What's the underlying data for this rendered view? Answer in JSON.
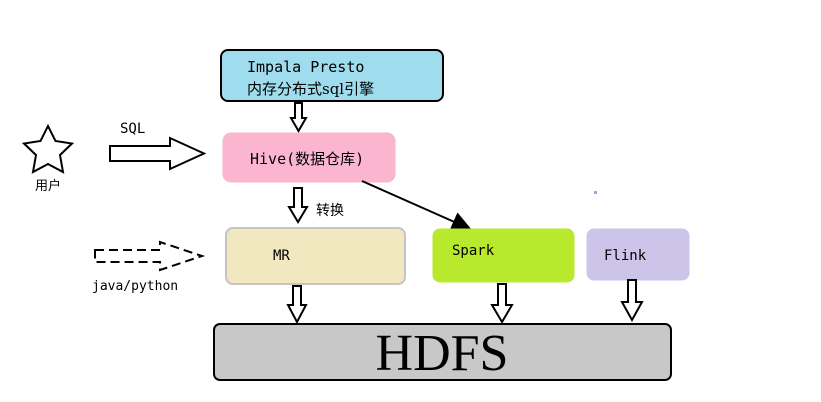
{
  "nodes": {
    "impala": {
      "line1": "Impala Presto",
      "line2": "内存分布式sql引擎",
      "fill": "#9fdcee"
    },
    "hive": {
      "label": "Hive(数据仓库)",
      "fill": "#fbb5cf"
    },
    "mr": {
      "label": "MR",
      "fill": "#f1e8bf"
    },
    "spark": {
      "label": "Spark",
      "fill": "#b9e92c"
    },
    "flink": {
      "label": "Flink",
      "fill": "#cdc4ea"
    },
    "hdfs": {
      "label": "HDFS",
      "fill": "#c8c8c8"
    }
  },
  "actors": {
    "user": {
      "label": "用户",
      "icon": "star-icon"
    }
  },
  "edges": {
    "sql": {
      "label": "SQL"
    },
    "convert": {
      "label": "转换"
    },
    "java_python": {
      "label": "java/python"
    }
  }
}
